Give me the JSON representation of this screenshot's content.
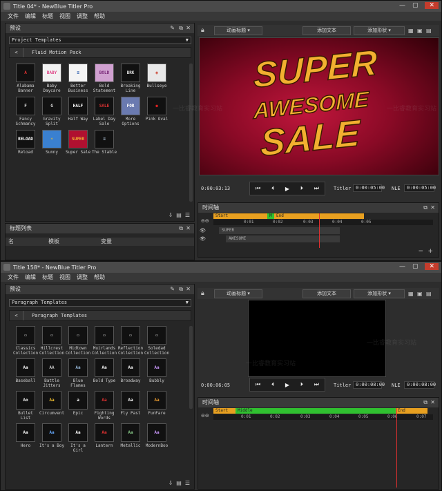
{
  "w1": {
    "title": "Title 04* - NewBlue Titler Pro",
    "menu": [
      "文件",
      "编辑",
      "标题",
      "视图",
      "调整",
      "帮助"
    ],
    "presets_label": "预设",
    "template_dropdown": "Project Templates",
    "pack_name": "Fluid Motion Pack",
    "thumbs": [
      {
        "label": "Alabama Banner",
        "bg": "#111",
        "fg": "#e33",
        "icon": "A"
      },
      {
        "label": "Baby Daycare",
        "bg": "#f2f2f2",
        "fg": "#e04a8a",
        "icon": "BABY"
      },
      {
        "label": "Better Business",
        "bg": "#f4f4f4",
        "fg": "#3060b0",
        "icon": "≡"
      },
      {
        "label": "Bold Statement",
        "bg": "#d0a0d0",
        "fg": "#7a2a7a",
        "icon": "BOLD"
      },
      {
        "label": "Breaking Line",
        "bg": "#111",
        "fg": "#ddd",
        "icon": "BRK"
      },
      {
        "label": "Bullseye",
        "bg": "#e8e8e8",
        "fg": "#c43",
        "icon": "◉"
      },
      {
        "label": "Fancy Schmancy",
        "bg": "#111",
        "fg": "#ddd",
        "icon": "F"
      },
      {
        "label": "Gravity Split",
        "bg": "#111",
        "fg": "#ddd",
        "icon": "G"
      },
      {
        "label": "Half Way",
        "bg": "#111",
        "fg": "#fff",
        "icon": "HALF"
      },
      {
        "label": "Label Day Sale",
        "bg": "#111",
        "fg": "#d33",
        "icon": "SALE"
      },
      {
        "label": "More Options",
        "bg": "#6a7ab0",
        "fg": "#fff",
        "icon": "FOR"
      },
      {
        "label": "Pink Oval",
        "bg": "#111",
        "fg": "#d22",
        "icon": "●"
      },
      {
        "label": "Reload",
        "bg": "#111",
        "fg": "#fff",
        "icon": "RELOAD"
      },
      {
        "label": "Sunny",
        "bg": "#3a80d0",
        "fg": "#f0c030",
        "icon": "☀"
      },
      {
        "label": "Super Sale",
        "bg": "#b01030",
        "fg": "#f2b030",
        "icon": "SUPER"
      },
      {
        "label": "The Stable",
        "bg": "#111",
        "fg": "#9ab",
        "icon": "≡"
      }
    ],
    "titles_list_label": "标题列表",
    "list_cols": [
      "名",
      "模板",
      "变量"
    ],
    "toolbar_dropdown": "动画标题",
    "add_text": "添加文本",
    "add_shape": "添加形状",
    "preview_lines": [
      "SUPER",
      "AWESOME",
      "SALE"
    ],
    "time_current": "0:00:03:13",
    "titler_label": "Titler",
    "titler_time": "0:00:05:00",
    "nle_label": "NLE",
    "nle_time": "0:00:05:00",
    "timeline_label": "时间轴",
    "seg_start": "Start",
    "seg_mid": "M",
    "seg_end": "End",
    "ruler_ticks": [
      "0:01",
      "0:02",
      "0:03",
      "0:04",
      "0:05"
    ],
    "layers": [
      "SUPER",
      "AWESOME"
    ],
    "zoom_minus": "−",
    "zoom_plus": "+"
  },
  "w2": {
    "title": "Title 158* - NewBlue Titler Pro",
    "menu": [
      "文件",
      "编辑",
      "标题",
      "视图",
      "调整",
      "帮助"
    ],
    "presets_label": "预设",
    "template_dropdown": "Paragraph Templates",
    "pack_name": "Paragraph Templates",
    "thumbs": [
      {
        "label": "Classics Collection",
        "bg": "#111",
        "fg": "#ddd",
        "icon": "▭"
      },
      {
        "label": "Hillcrest Collection",
        "bg": "#111",
        "fg": "#ddd",
        "icon": "▭"
      },
      {
        "label": "Midtown Collection",
        "bg": "#111",
        "fg": "#ddd",
        "icon": "▭"
      },
      {
        "label": "Muirlands Collection",
        "bg": "#111",
        "fg": "#ddd",
        "icon": "▭"
      },
      {
        "label": "Reflection Collection",
        "bg": "#111",
        "fg": "#ddd",
        "icon": "▭"
      },
      {
        "label": "Soledad Collection",
        "bg": "#111",
        "fg": "#ddd",
        "icon": "▭"
      },
      {
        "label": "Baseball",
        "bg": "#111",
        "fg": "#fff",
        "icon": "Aa"
      },
      {
        "label": "Battle Jitters",
        "bg": "#111",
        "fg": "#ccc",
        "icon": "AA"
      },
      {
        "label": "Blue Flames",
        "bg": "#111",
        "fg": "#9bd",
        "icon": "Aa"
      },
      {
        "label": "Bold Type",
        "bg": "#111",
        "fg": "#fff",
        "icon": "Aa"
      },
      {
        "label": "Broadway",
        "bg": "#111",
        "fg": "#fff",
        "icon": "Aa"
      },
      {
        "label": "Bubbly",
        "bg": "#111",
        "fg": "#c9f",
        "icon": "Aa"
      },
      {
        "label": "Bullet List",
        "bg": "#111",
        "fg": "#fff",
        "icon": "Ao"
      },
      {
        "label": "Circumvent",
        "bg": "#111",
        "fg": "#f2c030",
        "icon": "Aa"
      },
      {
        "label": "Epic",
        "bg": "#111",
        "fg": "#fff",
        "icon": "a"
      },
      {
        "label": "Fighting Words",
        "bg": "#111",
        "fg": "#e33",
        "icon": "Aa"
      },
      {
        "label": "Fly Past",
        "bg": "#111",
        "fg": "#fff",
        "icon": "Aa"
      },
      {
        "label": "FunFare",
        "bg": "#111",
        "fg": "#f2a030",
        "icon": "Aa"
      },
      {
        "label": "Hero",
        "bg": "#111",
        "fg": "#fff",
        "icon": "Aa"
      },
      {
        "label": "It's a Boy",
        "bg": "#111",
        "fg": "#6af",
        "icon": "Aa"
      },
      {
        "label": "It's a Girl",
        "bg": "#111",
        "fg": "#fff",
        "icon": "Aa"
      },
      {
        "label": "Lantern",
        "bg": "#111",
        "fg": "#e33",
        "icon": "Aa"
      },
      {
        "label": "Metallic",
        "bg": "#111",
        "fg": "#8c8",
        "icon": "Aa"
      },
      {
        "label": "ModernBoo",
        "bg": "#111",
        "fg": "#c9f",
        "icon": "Aa"
      }
    ],
    "toolbar_dropdown": "动画标题",
    "add_text": "添加文本",
    "add_shape": "添加形状",
    "time_current": "0:00:06:05",
    "titler_label": "Titler",
    "titler_time": "0:00:08:00",
    "nle_label": "NLE",
    "nle_time": "0:00:08:00",
    "timeline_label": "时间轴",
    "seg_start": "Start",
    "seg_mid": "Middle",
    "seg_end": "End",
    "ruler_ticks": [
      "0:01",
      "0:02",
      "0:03",
      "0:04",
      "0:05",
      "0:06",
      "0:07"
    ]
  },
  "watermark": "一比睿教育实习站"
}
